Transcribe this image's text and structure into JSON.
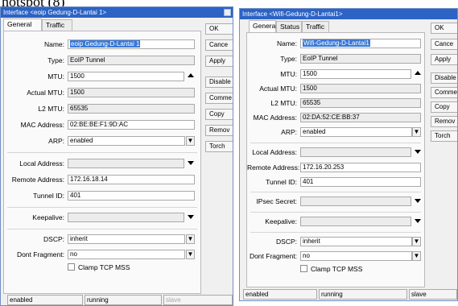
{
  "top_text": "hotspot (8)",
  "left": {
    "title": "Interface <eoip Gedung-D-Lantai 1>",
    "tabs": [
      "General",
      "Traffic"
    ],
    "fields": {
      "name": {
        "label": "Name:",
        "value": "eoip Gedung-D-Lantai 1"
      },
      "type": {
        "label": "Type:",
        "value": "EoIP Tunnel"
      },
      "mtu": {
        "label": "MTU:",
        "value": "1500"
      },
      "actual_mtu": {
        "label": "Actual MTU:",
        "value": "1500"
      },
      "l2_mtu": {
        "label": "L2 MTU:",
        "value": "65535"
      },
      "mac": {
        "label": "MAC Address:",
        "value": "02:BE:BE:F1:9D:AC"
      },
      "arp": {
        "label": "ARP:",
        "value": "enabled"
      },
      "local_address": {
        "label": "Local Address:",
        "value": ""
      },
      "remote_address": {
        "label": "Remote Address:",
        "value": "172.16.18.14"
      },
      "tunnel_id": {
        "label": "Tunnel ID:",
        "value": "401"
      },
      "keepalive": {
        "label": "Keepalive:",
        "value": ""
      },
      "dscp": {
        "label": "DSCP:",
        "value": "inherit"
      },
      "dont_fragment": {
        "label": "Dont Fragment:",
        "value": "no"
      },
      "clamp": {
        "label": "Clamp TCP MSS"
      }
    },
    "buttons": [
      "OK",
      "Cance",
      "Apply",
      "Disable",
      "Comme",
      "Copy",
      "Remov",
      "Torch"
    ],
    "status": [
      "enabled",
      "running",
      "slave"
    ]
  },
  "right": {
    "title": "Interface <Wifi-Gedung-D-Lantai1>",
    "tabs": [
      "General",
      "Status",
      "Traffic"
    ],
    "fields": {
      "name": {
        "label": "Name:",
        "value": "Wifi-Gedung-D-Lantai1"
      },
      "type": {
        "label": "Type:",
        "value": "EoIP Tunnel"
      },
      "mtu": {
        "label": "MTU:",
        "value": "1500"
      },
      "actual_mtu": {
        "label": "Actual MTU:",
        "value": "1500"
      },
      "l2_mtu": {
        "label": "L2 MTU:",
        "value": "65535"
      },
      "mac": {
        "label": "MAC Address:",
        "value": "02:DA:52:CE:BB:37"
      },
      "arp": {
        "label": "ARP:",
        "value": "enabled"
      },
      "local_address": {
        "label": "Local Address:",
        "value": ""
      },
      "remote_address": {
        "label": "Remote Address:",
        "value": "172.16.20.253"
      },
      "tunnel_id": {
        "label": "Tunnel ID:",
        "value": "401"
      },
      "ipsec_secret": {
        "label": "IPsec Secret:",
        "value": ""
      },
      "keepalive": {
        "label": "Keepalive:",
        "value": ""
      },
      "dscp": {
        "label": "DSCP:",
        "value": "inherit"
      },
      "dont_fragment": {
        "label": "Dont Fragment:",
        "value": "no"
      },
      "clamp": {
        "label": "Clamp TCP MSS"
      }
    },
    "buttons": [
      "OK",
      "Cance",
      "Apply",
      "Disable",
      "Comme",
      "Copy",
      "Remov",
      "Torch"
    ],
    "status": [
      "enabled",
      "running",
      "slave"
    ]
  }
}
